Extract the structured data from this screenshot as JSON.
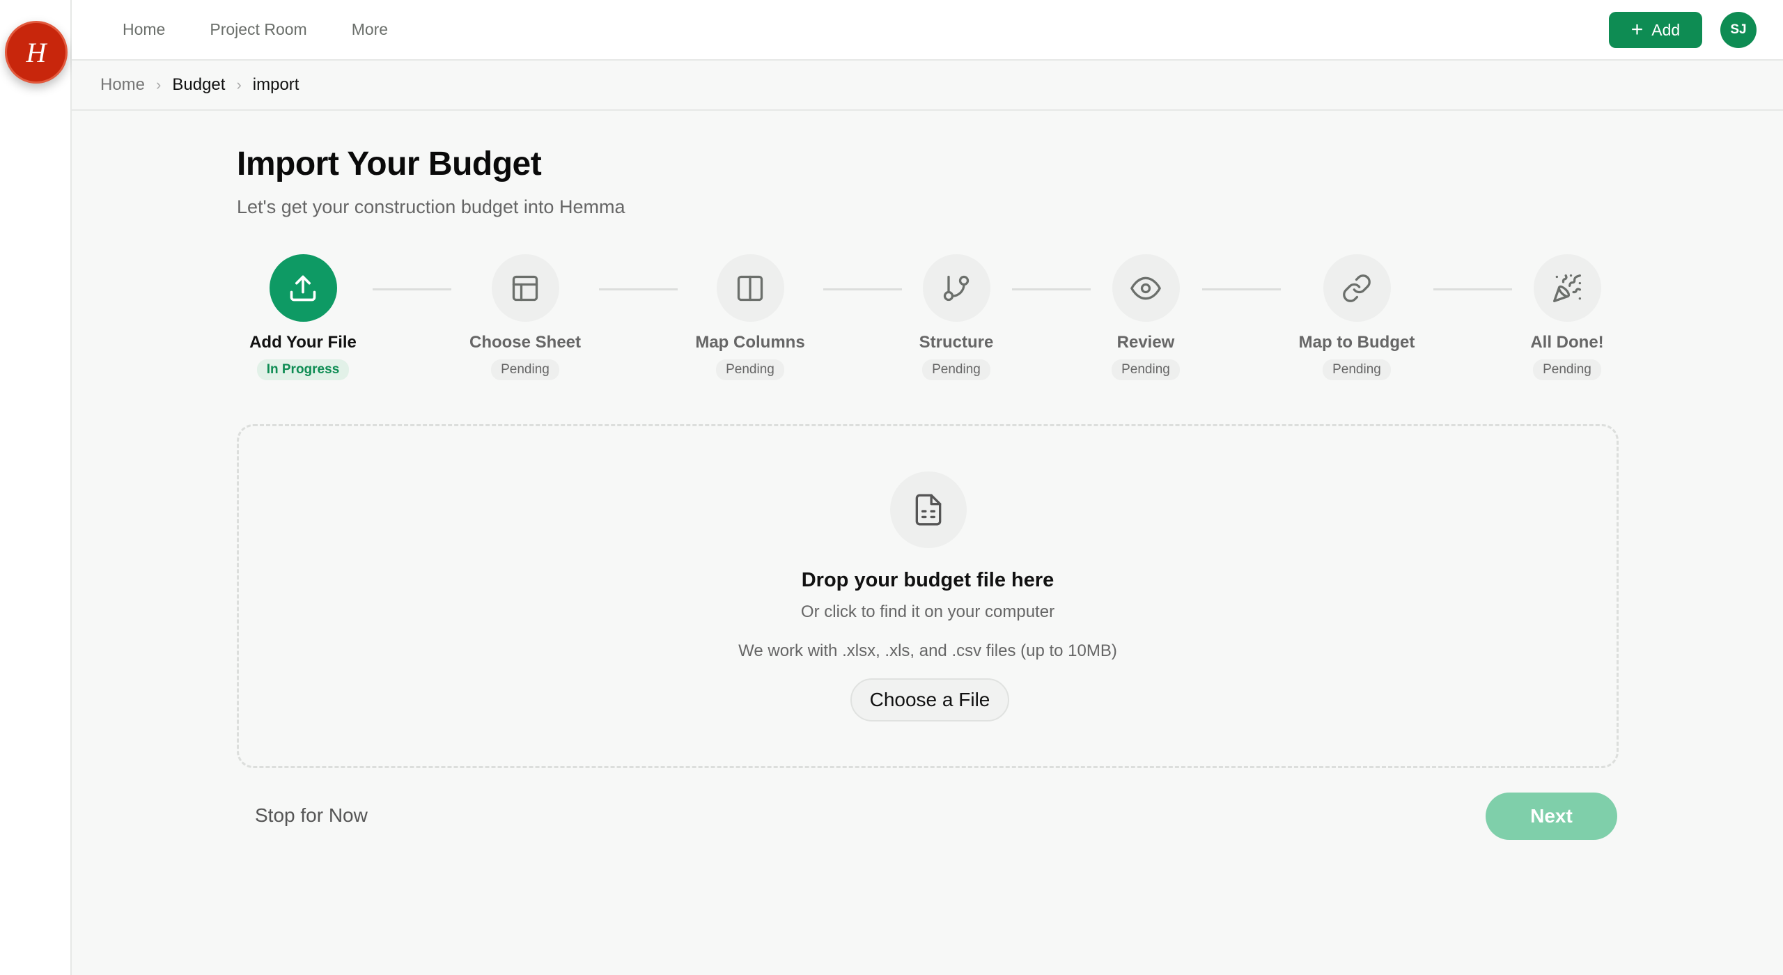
{
  "app": {
    "logo_letter": "H"
  },
  "topnav": {
    "items": [
      {
        "label": "Home"
      },
      {
        "label": "Project Room"
      },
      {
        "label": "More"
      }
    ],
    "add_label": "Add",
    "avatar_initials": "SJ"
  },
  "breadcrumb": {
    "items": [
      {
        "label": "Home"
      },
      {
        "label": "Budget"
      },
      {
        "label": "import"
      }
    ]
  },
  "header": {
    "title": "Import Your Budget",
    "subtitle": "Let's get your construction budget into Hemma"
  },
  "steps": [
    {
      "label": "Add Your File",
      "status": "In Progress",
      "icon": "upload-icon",
      "active": true
    },
    {
      "label": "Choose Sheet",
      "status": "Pending",
      "icon": "table-icon",
      "active": false
    },
    {
      "label": "Map Columns",
      "status": "Pending",
      "icon": "columns-icon",
      "active": false
    },
    {
      "label": "Structure",
      "status": "Pending",
      "icon": "git-branch-icon",
      "active": false
    },
    {
      "label": "Review",
      "status": "Pending",
      "icon": "eye-icon",
      "active": false
    },
    {
      "label": "Map to Budget",
      "status": "Pending",
      "icon": "link-icon",
      "active": false
    },
    {
      "label": "All Done!",
      "status": "Pending",
      "icon": "party-popper-icon",
      "active": false
    }
  ],
  "dropzone": {
    "icon": "file-spreadsheet-icon",
    "title": "Drop your budget file here",
    "subtitle": "Or click to find it on your computer",
    "formats": "We work with .xlsx, .xls, and .csv files (up to 10MB)",
    "button_label": "Choose a File"
  },
  "footer": {
    "stop_label": "Stop for Now",
    "next_label": "Next"
  },
  "colors": {
    "brand_green": "#0e8c53",
    "logo_red": "#c8260c",
    "next_disabled": "#7fcfaa"
  }
}
